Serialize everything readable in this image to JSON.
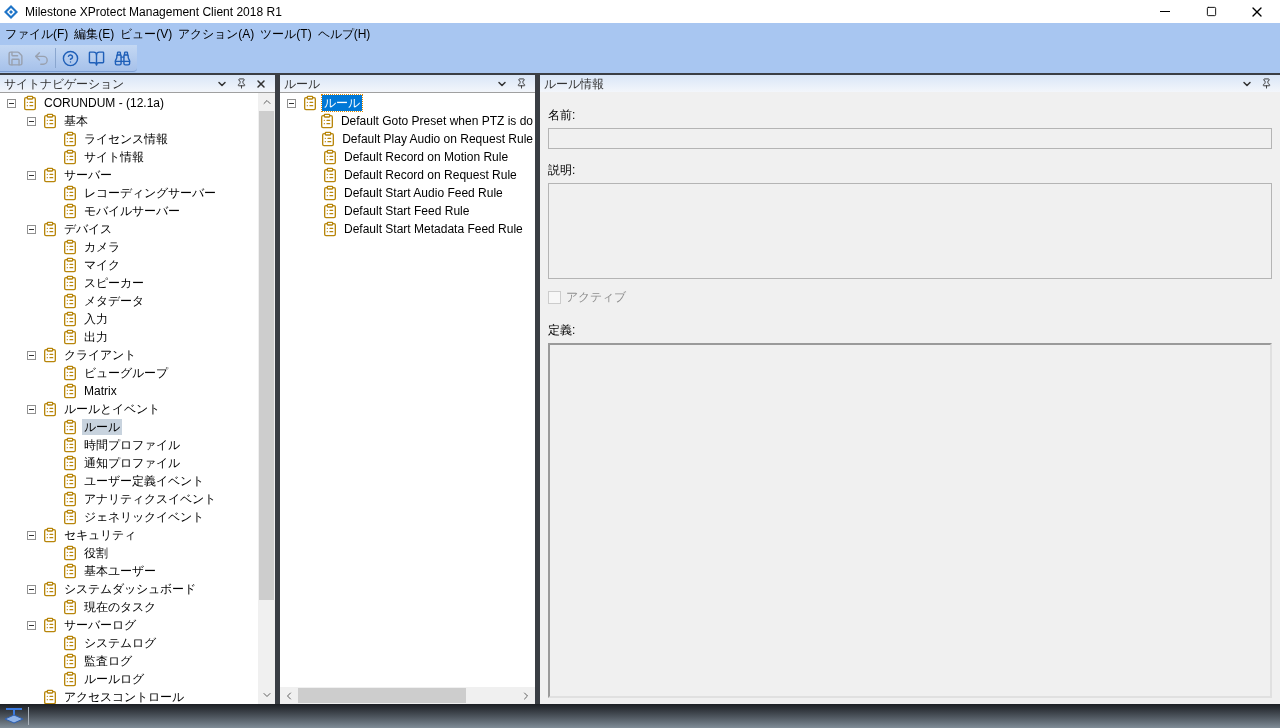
{
  "window": {
    "title": "Milestone XProtect Management Client 2018 R1"
  },
  "menu": [
    "ファイル(F)",
    "編集(E)",
    "ビュー(V)",
    "アクション(A)",
    "ツール(T)",
    "ヘルプ(H)"
  ],
  "toolbar": [
    {
      "kind": "save",
      "disabled": true
    },
    {
      "kind": "undo",
      "disabled": true
    },
    {
      "kind": "help",
      "disabled": false
    },
    {
      "kind": "book",
      "disabled": false
    },
    {
      "kind": "binoculars",
      "disabled": false
    }
  ],
  "site_navigation": {
    "title": "サイトナビゲーション",
    "closable": true,
    "tree": [
      {
        "label": "CORUNDUM - (12.1a)",
        "selected": false,
        "expanded": true,
        "children": [
          {
            "label": "基本",
            "selected": false,
            "expanded": true,
            "children": [
              {
                "label": "ライセンス情報",
                "selected": false
              },
              {
                "label": "サイト情報",
                "selected": false
              }
            ]
          },
          {
            "label": "サーバー",
            "selected": false,
            "expanded": true,
            "children": [
              {
                "label": "レコーディングサーバー",
                "selected": false
              },
              {
                "label": "モバイルサーバー",
                "selected": false
              }
            ]
          },
          {
            "label": "デバイス",
            "selected": false,
            "expanded": true,
            "children": [
              {
                "label": "カメラ",
                "selected": false
              },
              {
                "label": "マイク",
                "selected": false
              },
              {
                "label": "スピーカー",
                "selected": false
              },
              {
                "label": "メタデータ",
                "selected": false
              },
              {
                "label": "入力",
                "selected": false
              },
              {
                "label": "出力",
                "selected": false
              }
            ]
          },
          {
            "label": "クライアント",
            "selected": false,
            "expanded": true,
            "children": [
              {
                "label": "ビューグループ",
                "selected": false
              },
              {
                "label": "Matrix",
                "selected": false
              }
            ]
          },
          {
            "label": "ルールとイベント",
            "selected": false,
            "expanded": true,
            "children": [
              {
                "label": "ルール",
                "selected": true
              },
              {
                "label": "時間プロファイル",
                "selected": false
              },
              {
                "label": "通知プロファイル",
                "selected": false
              },
              {
                "label": "ユーザー定義イベント",
                "selected": false
              },
              {
                "label": "アナリティクスイベント",
                "selected": false
              },
              {
                "label": "ジェネリックイベント",
                "selected": false
              }
            ]
          },
          {
            "label": "セキュリティ",
            "selected": false,
            "expanded": true,
            "children": [
              {
                "label": "役割",
                "selected": false
              },
              {
                "label": "基本ユーザー",
                "selected": false
              }
            ]
          },
          {
            "label": "システムダッシュボード",
            "selected": false,
            "expanded": true,
            "children": [
              {
                "label": "現在のタスク",
                "selected": false
              }
            ]
          },
          {
            "label": "サーバーログ",
            "selected": false,
            "expanded": true,
            "children": [
              {
                "label": "システムログ",
                "selected": false
              },
              {
                "label": "監査ログ",
                "selected": false
              },
              {
                "label": "ルールログ",
                "selected": false
              }
            ]
          },
          {
            "label": "アクセスコントロール",
            "selected": false
          }
        ]
      }
    ]
  },
  "rules_pane": {
    "title": "ルール",
    "tree": [
      {
        "label": "ルール",
        "selected": true,
        "expanded": true,
        "children": [
          {
            "label": "Default Goto Preset when PTZ is do",
            "selected": false
          },
          {
            "label": "Default Play Audio on Request Rule",
            "selected": false
          },
          {
            "label": "Default Record on Motion Rule",
            "selected": false
          },
          {
            "label": "Default Record on Request Rule",
            "selected": false
          },
          {
            "label": "Default Start Audio Feed Rule",
            "selected": false
          },
          {
            "label": "Default Start Feed Rule",
            "selected": false
          },
          {
            "label": "Default Start Metadata Feed Rule",
            "selected": false
          }
        ]
      }
    ]
  },
  "rule_info": {
    "title": "ルール情報",
    "name_label": "名前:",
    "description_label": "説明:",
    "active": {
      "label": "アクティブ",
      "checked": false,
      "disabled": true
    },
    "definition_label": "定義:"
  }
}
